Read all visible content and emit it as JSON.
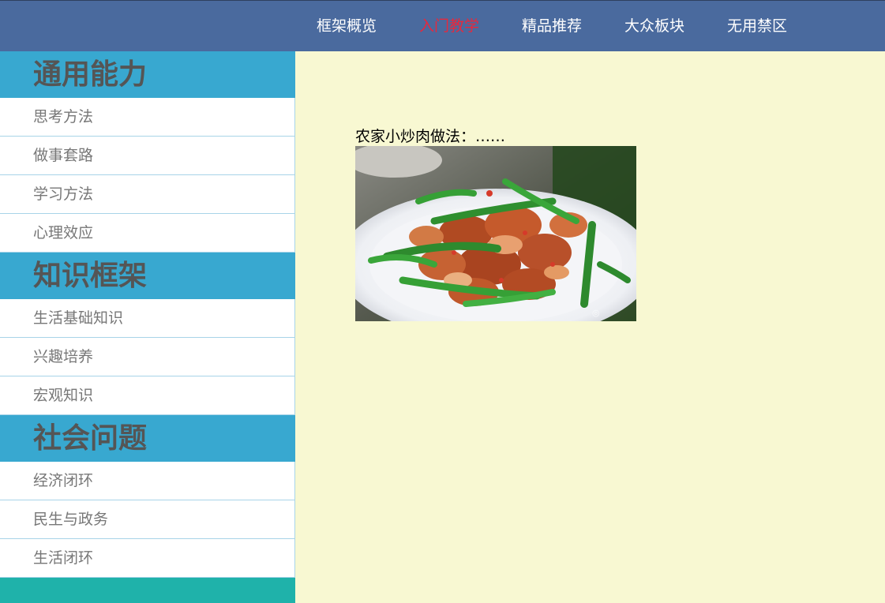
{
  "nav": {
    "items": [
      {
        "label": "框架概览"
      },
      {
        "label": "入门教学",
        "active": true
      },
      {
        "label": "精品推荐"
      },
      {
        "label": "大众板块"
      },
      {
        "label": "无用禁区"
      }
    ]
  },
  "sidebar": {
    "sections": [
      {
        "title": "通用能力",
        "items": [
          "思考方法",
          "做事套路",
          "学习方法",
          "心理效应"
        ]
      },
      {
        "title": "知识框架",
        "items": [
          "生活基础知识",
          "兴趣培养",
          "宏观知识"
        ]
      },
      {
        "title": "社会问题",
        "items": [
          "经济闭环",
          "民生与政务",
          "生活闭环"
        ]
      }
    ]
  },
  "content": {
    "caption": "农家小炒肉做法：……",
    "image": {
      "subject": "stir-fried pork with green peppers on a white plate"
    }
  },
  "colors": {
    "nav_bg": "#4a6a9e",
    "nav_active": "#e8283c",
    "section_bg": "#38a8d0",
    "sidebar_footer": "#1fb2aa",
    "main_bg": "#f8f8d2"
  }
}
